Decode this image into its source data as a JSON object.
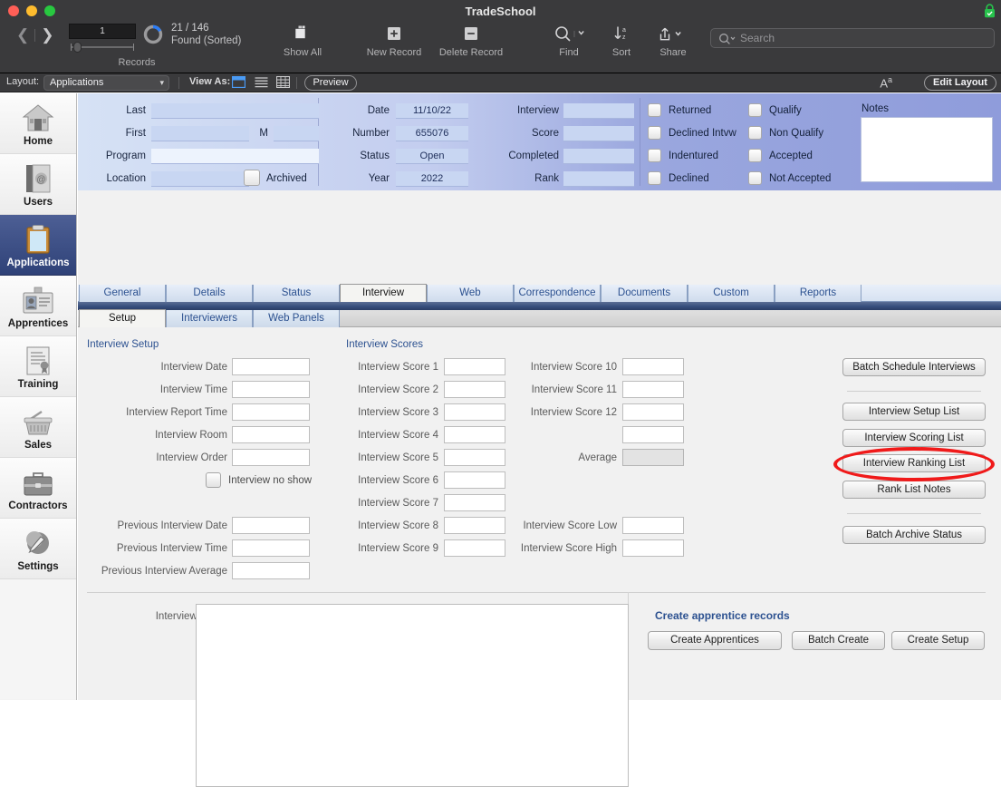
{
  "window": {
    "title": "TradeSchool",
    "lock_icon": "lock-icon"
  },
  "toolbar": {
    "record_number": "1",
    "found_count": "21 / 146",
    "found_status": "Found (Sorted)",
    "records_label": "Records",
    "items": [
      {
        "label": "Show All",
        "icon": "show-all-icon"
      },
      {
        "label": "New Record",
        "icon": "plus-square-icon"
      },
      {
        "label": "Delete Record",
        "icon": "minus-square-icon"
      },
      {
        "label": "Find",
        "icon": "magnifier-icon"
      },
      {
        "label": "Sort",
        "icon": "sort-az-icon"
      },
      {
        "label": "Share",
        "icon": "share-icon"
      }
    ],
    "search_placeholder": "Search"
  },
  "layoutbar": {
    "layout_label": "Layout:",
    "layout_value": "Applications",
    "view_as_label": "View As:",
    "view_modes": [
      "form-view-icon",
      "list-view-icon",
      "table-view-icon"
    ],
    "preview_label": "Preview",
    "text_size_icon": "text-size-icon",
    "edit_layout_label": "Edit Layout"
  },
  "sidebar": {
    "items": [
      {
        "label": "Home",
        "icon": "house-icon",
        "active": false
      },
      {
        "label": "Users",
        "icon": "address-book-icon",
        "active": false
      },
      {
        "label": "Applications",
        "icon": "clipboard-icon",
        "active": true
      },
      {
        "label": "Apprentices",
        "icon": "id-card-icon",
        "active": false
      },
      {
        "label": "Training",
        "icon": "certificate-icon",
        "active": false
      },
      {
        "label": "Sales",
        "icon": "basket-icon",
        "active": false
      },
      {
        "label": "Contractors",
        "icon": "briefcase-icon",
        "active": false
      },
      {
        "label": "Settings",
        "icon": "wrench-icon",
        "active": false
      }
    ]
  },
  "header": {
    "left_fields": [
      {
        "label": "Last",
        "value": ""
      },
      {
        "label": "First",
        "value": ""
      },
      {
        "label": "M",
        "value": ""
      },
      {
        "label": "Program",
        "value": ""
      },
      {
        "label": "Location",
        "value": ""
      }
    ],
    "archived_label": "Archived",
    "mid_fields": [
      {
        "label": "Date",
        "value": "11/10/22"
      },
      {
        "label": "Number",
        "value": "655076"
      },
      {
        "label": "Status",
        "value": "Open"
      },
      {
        "label": "Year",
        "value": "2022"
      }
    ],
    "right_fields": [
      {
        "label": "Interview",
        "value": ""
      },
      {
        "label": "Score",
        "value": ""
      },
      {
        "label": "Completed",
        "value": ""
      },
      {
        "label": "Rank",
        "value": ""
      }
    ],
    "checkboxes_col1": [
      "Returned",
      "Declined Intvw",
      "Indentured",
      "Declined"
    ],
    "checkboxes_col2": [
      "Qualify",
      "Non Qualify",
      "Accepted",
      "Not Accepted"
    ],
    "notes_label": "Notes",
    "notes_value": ""
  },
  "tabs_primary": [
    {
      "label": "General",
      "selected": false
    },
    {
      "label": "Details",
      "selected": false
    },
    {
      "label": "Status",
      "selected": false
    },
    {
      "label": "Interview",
      "selected": true
    },
    {
      "label": "Web",
      "selected": false
    },
    {
      "label": "Correspondence",
      "selected": false
    },
    {
      "label": "Documents",
      "selected": false
    },
    {
      "label": "Custom",
      "selected": false
    },
    {
      "label": "Reports",
      "selected": false
    }
  ],
  "tabs_secondary": [
    {
      "label": "Setup",
      "selected": true
    },
    {
      "label": "Interviewers",
      "selected": false
    },
    {
      "label": "Web Panels",
      "selected": false
    }
  ],
  "interview_setup": {
    "title": "Interview Setup",
    "fields": [
      {
        "label": "Interview Date",
        "value": ""
      },
      {
        "label": "Interview Time",
        "value": ""
      },
      {
        "label": "Interview Report Time",
        "value": ""
      },
      {
        "label": "Interview Room",
        "value": ""
      },
      {
        "label": "Interview Order",
        "value": ""
      }
    ],
    "no_show_label": "Interview no show",
    "previous_fields": [
      {
        "label": "Previous Interview Date",
        "value": ""
      },
      {
        "label": "Previous Interview Time",
        "value": ""
      },
      {
        "label": "Previous Interview Average",
        "value": ""
      }
    ]
  },
  "interview_scores": {
    "title": "Interview Scores",
    "col1": [
      {
        "label": "Interview Score 1",
        "value": ""
      },
      {
        "label": "Interview Score 2",
        "value": ""
      },
      {
        "label": "Interview Score 3",
        "value": ""
      },
      {
        "label": "Interview Score 4",
        "value": ""
      },
      {
        "label": "Interview Score 5",
        "value": ""
      },
      {
        "label": "Interview Score 6",
        "value": ""
      },
      {
        "label": "Interview Score 7",
        "value": ""
      },
      {
        "label": "Interview Score 8",
        "value": ""
      },
      {
        "label": "Interview Score 9",
        "value": ""
      }
    ],
    "col2": [
      {
        "label": "Interview Score 10",
        "value": ""
      },
      {
        "label": "Interview Score 11",
        "value": ""
      },
      {
        "label": "Interview Score 12",
        "value": ""
      },
      {
        "label": "",
        "value": ""
      },
      {
        "label": "Average",
        "value": ""
      },
      {
        "label": "Interview Score Low",
        "value": ""
      },
      {
        "label": "Interview Score High",
        "value": ""
      }
    ]
  },
  "action_buttons": {
    "group1": [
      "Batch Schedule Interviews"
    ],
    "group2": [
      "Interview Setup List",
      "Interview Scoring List",
      "Interview Ranking List",
      "Rank List Notes"
    ],
    "group3": [
      "Batch Archive Status"
    ],
    "highlighted": "Interview Ranking List",
    "highlight_color": "#f01a1a"
  },
  "notes_section": {
    "label": "Interview Notes",
    "value": ""
  },
  "create_section": {
    "title": "Create apprentice records",
    "buttons": [
      "Create Apprentices",
      "Batch Create",
      "Create Setup"
    ]
  }
}
